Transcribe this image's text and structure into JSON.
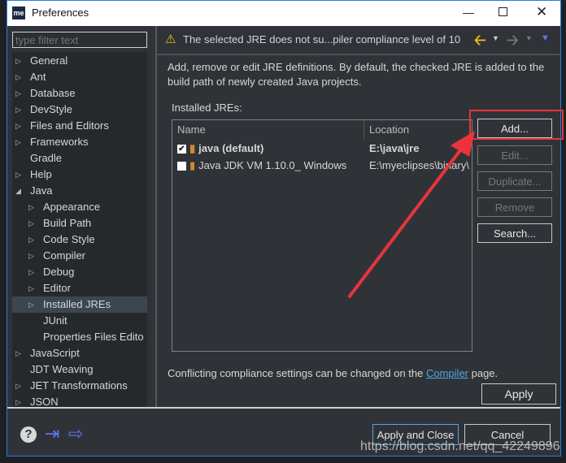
{
  "window": {
    "title": "Preferences",
    "logo": "me",
    "controls": [
      "minimize-icon",
      "maximize-icon",
      "close-icon"
    ]
  },
  "filter": {
    "placeholder": "type filter text"
  },
  "tree": [
    {
      "label": "General",
      "expandable": true,
      "level": 0
    },
    {
      "label": "Ant",
      "expandable": true,
      "level": 0
    },
    {
      "label": "Database",
      "expandable": true,
      "level": 0
    },
    {
      "label": "DevStyle",
      "expandable": true,
      "level": 0
    },
    {
      "label": "Files and Editors",
      "expandable": true,
      "level": 0
    },
    {
      "label": "Frameworks",
      "expandable": true,
      "level": 0
    },
    {
      "label": "Gradle",
      "expandable": false,
      "level": 0
    },
    {
      "label": "Help",
      "expandable": true,
      "level": 0
    },
    {
      "label": "Java",
      "expandable": true,
      "expanded": true,
      "level": 0
    },
    {
      "label": "Appearance",
      "expandable": true,
      "level": 1
    },
    {
      "label": "Build Path",
      "expandable": true,
      "level": 1
    },
    {
      "label": "Code Style",
      "expandable": true,
      "level": 1
    },
    {
      "label": "Compiler",
      "expandable": true,
      "level": 1
    },
    {
      "label": "Debug",
      "expandable": true,
      "level": 1
    },
    {
      "label": "Editor",
      "expandable": true,
      "level": 1
    },
    {
      "label": "Installed JREs",
      "expandable": true,
      "level": 1,
      "selected": true
    },
    {
      "label": "JUnit",
      "expandable": false,
      "level": 1
    },
    {
      "label": "Properties Files Edito",
      "expandable": false,
      "level": 1
    },
    {
      "label": "JavaScript",
      "expandable": true,
      "level": 0
    },
    {
      "label": "JDT Weaving",
      "expandable": false,
      "level": 0
    },
    {
      "label": "JET Transformations",
      "expandable": true,
      "level": 0
    },
    {
      "label": "JSON",
      "expandable": true,
      "level": 0
    }
  ],
  "warning": {
    "text": "The selected JRE does not su...piler compliance level of 10"
  },
  "description": "Add, remove or edit JRE definitions. By default, the checked JRE is added to the build path of newly created Java projects.",
  "installed_label": "Installed JREs:",
  "table": {
    "columns": [
      "Name",
      "Location"
    ],
    "rows": [
      {
        "name": "java (default)",
        "location": "E:\\java\\jre",
        "checked": true
      },
      {
        "name": "Java JDK VM 1.10.0_ Windows",
        "location": "E:\\myeclipses\\binary\\",
        "checked": false
      }
    ]
  },
  "buttons": {
    "add": "Add...",
    "edit": "Edit...",
    "duplicate": "Duplicate...",
    "remove": "Remove",
    "search": "Search...",
    "apply": "Apply",
    "apply_close": "Apply and Close",
    "cancel": "Cancel"
  },
  "compliance": {
    "before": "Conflicting compliance settings can be changed on the ",
    "link": "Compiler",
    "after": " page."
  },
  "watermark": "https://blog.csdn.net/qq_42249896",
  "colors": {
    "highlight": "#e8343a",
    "link": "#4fa8e0",
    "warning": "#f2c21b"
  }
}
